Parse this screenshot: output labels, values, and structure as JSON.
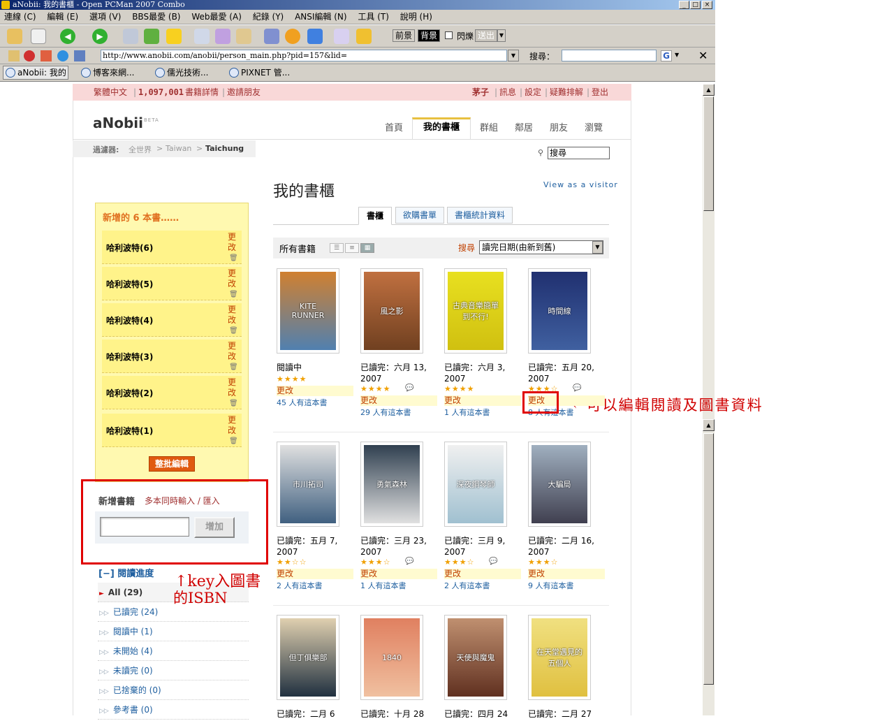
{
  "window": {
    "title": "aNobii: 我的書櫃 - Open PCMan 2007 Combo"
  },
  "menu": [
    "連線 (C)",
    "編輯 (E)",
    "選項 (V)",
    "BBS最愛 (B)",
    "Web最愛 (A)",
    "紀錄 (Y)",
    "ANSI編輯 (N)",
    "工具 (T)",
    "說明 (H)"
  ],
  "toolbar": {
    "fg": "前景",
    "bg": "背景",
    "blink": "閃爍",
    "send": "送出"
  },
  "address": {
    "url": "http://www.anobii.com/anobii/person_main.php?pid=157&lid=",
    "search_label": "搜尋："
  },
  "tabs": [
    "aNobii: 我的",
    "博客來網...",
    "儒光技術...",
    "PIXNET 管..."
  ],
  "top": {
    "left": [
      "繁體中文",
      "1,097,001",
      "書籍詳情",
      "邀請朋友"
    ],
    "right": [
      "茅子",
      "訊息",
      "設定",
      "疑難排解",
      "登出"
    ]
  },
  "logo": {
    "text": "aNobii",
    "beta": "BETA"
  },
  "nav": [
    "首頁",
    "我的書櫃",
    "群組",
    "鄰居",
    "朋友",
    "瀏覽"
  ],
  "filter": {
    "label": "過濾器:",
    "path": [
      "全世界",
      "Taiwan",
      "Taichung"
    ],
    "search": "搜尋"
  },
  "heading": "我的書櫃",
  "view_as": "View as a visitor",
  "subtabs": [
    "書櫃",
    "欲購書單",
    "書櫃統計資料"
  ],
  "list_header": {
    "all": "所有書籍",
    "sort_label": "搜尋",
    "sort_value": "讀完日期(由新到舊)"
  },
  "sidebar": {
    "new_books_title": "新增的 6 本書……",
    "new_books": [
      "哈利波特(6)",
      "哈利波特(5)",
      "哈利波特(4)",
      "哈利波特(3)",
      "哈利波特(2)",
      "哈利波特(1)"
    ],
    "edit_label": "更改",
    "batch": "整批編輯",
    "add_title": "新增書籍",
    "add_link": "多本同時輸入 / 匯入",
    "add_button": "增加",
    "progress_title": "[−] 閱讀進度",
    "progress": [
      "All (29)",
      "已讀完 (24)",
      "閱讀中 (1)",
      "未開始 (4)",
      "未讀完 (0)",
      "已捨棄的 (0)",
      "參考書 (0)"
    ]
  },
  "books": [
    {
      "status": "閱讀中",
      "status2": "",
      "stars": 4,
      "edit": "更改",
      "owners": "45 人有這本書",
      "cover_text": "KITE RUNNER"
    },
    {
      "status": "已讀完：六月 13,",
      "status2": "2007",
      "stars": 4,
      "edit": "更改",
      "owners": "29 人有這本書",
      "cover_text": "風之影"
    },
    {
      "status": "已讀完：六月 3,",
      "status2": "2007",
      "stars": 4,
      "edit": "更改",
      "owners": "1 人有這本書",
      "cover_text": "古典音樂簡單到不行!"
    },
    {
      "status": "已讀完：五月 20,",
      "status2": "2007",
      "stars": 3,
      "edit": "更改",
      "owners": "8 人有這本書",
      "cover_text": "時間線"
    },
    {
      "status": "已讀完：五月 7,",
      "status2": "2007",
      "stars": 2,
      "edit": "更改",
      "owners": "2 人有這本書",
      "cover_text": "市川拓司"
    },
    {
      "status": "已讀完：三月 23,",
      "status2": "2007",
      "stars": 3,
      "edit": "更改",
      "owners": "1 人有這本書",
      "cover_text": "勇氣森林"
    },
    {
      "status": "已讀完：三月 9,",
      "status2": "2007",
      "stars": 3,
      "edit": "更改",
      "owners": "2 人有這本書",
      "cover_text": "深夜鋼琴師"
    },
    {
      "status": "已讀完：二月 16,",
      "status2": "2007",
      "stars": 3,
      "edit": "更改",
      "owners": "9 人有這本書",
      "cover_text": "大騙局"
    },
    {
      "status": "已讀完：二月 6",
      "status2": "",
      "stars": 0,
      "edit": "",
      "owners": "",
      "cover_text": "但丁俱樂部"
    },
    {
      "status": "已讀完：十月 28",
      "status2": "",
      "stars": 0,
      "edit": "",
      "owners": "",
      "cover_text": "1840"
    },
    {
      "status": "已讀完：四月 24",
      "status2": "",
      "stars": 0,
      "edit": "",
      "owners": "",
      "cover_text": "天使與魔鬼"
    },
    {
      "status": "已讀完：二月 27",
      "status2": "",
      "stars": 0,
      "edit": "",
      "owners": "",
      "cover_text": "在天堂遇見的五個人"
    }
  ],
  "annotations": {
    "edit_note": "←可以編輯閱讀及圖書資料",
    "isbn_note_1": "↑key入圖書",
    "isbn_note_2": "的ISBN"
  },
  "colors": {
    "accent": "#e05a10",
    "link": "#2060a0",
    "maroon": "#a03030",
    "annotation": "#d00000",
    "sidebar_bg": "#fff9b0"
  }
}
